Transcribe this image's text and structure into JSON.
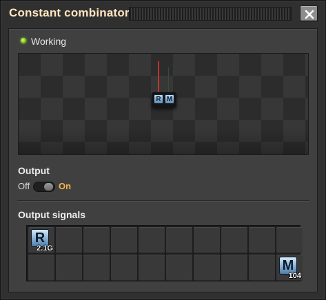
{
  "window": {
    "title": "Constant combinator",
    "close_icon": "close-icon"
  },
  "status": {
    "text": "Working",
    "color": "#7fc31c"
  },
  "preview": {
    "signals": [
      "R",
      "M"
    ],
    "wire_colors": [
      "#c2352b",
      "#3b4b3b"
    ]
  },
  "output": {
    "label": "Output",
    "off_label": "Off",
    "on_label": "On",
    "state": "on",
    "accent": "#f3b64a"
  },
  "signals": {
    "label": "Output signals",
    "slots": [
      {
        "letter": "R",
        "count": "2.1G"
      },
      {},
      {},
      {},
      {},
      {},
      {},
      {},
      {},
      {},
      {},
      {},
      {},
      {},
      {},
      {},
      {},
      {},
      {},
      {
        "letter": "M",
        "count": "104"
      }
    ]
  }
}
